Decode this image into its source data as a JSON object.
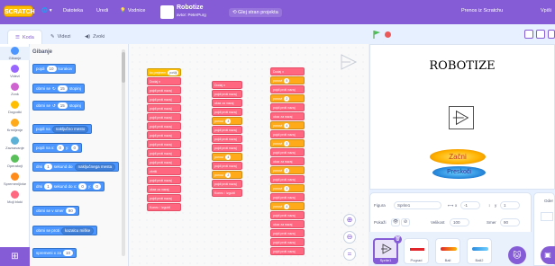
{
  "menubar": {
    "logo": "SCRATCH",
    "language_icon": "globe-icon",
    "file_label": "Datoteka",
    "edit_label": "Uredi",
    "tutorials_label": "Vodnice",
    "project_title": "Robotize",
    "project_author": "avtor: PeterPurg",
    "see_project_page": "Glej stran projekta",
    "share_label": "Prenos iz Scratchu",
    "my_stuff_label": "Vpiši"
  },
  "tabs": {
    "code": "Koda",
    "costumes": "Videzi",
    "sounds": "Zvoki"
  },
  "categories": [
    {
      "label": "Gibanje",
      "color": "#4c97ff"
    },
    {
      "label": "Videzi",
      "color": "#9966ff"
    },
    {
      "label": "Zvok",
      "color": "#cf63cf"
    },
    {
      "label": "Dogodki",
      "color": "#ffbf00"
    },
    {
      "label": "Krmiljenje",
      "color": "#ffab19"
    },
    {
      "label": "Zaznavanje",
      "color": "#5cb1d6"
    },
    {
      "label": "Operatorji",
      "color": "#59c059"
    },
    {
      "label": "Spremenljivke",
      "color": "#ff8c1a"
    },
    {
      "label": "Moji bloki",
      "color": "#ff6680"
    }
  ],
  "palette": {
    "header": "Gibanje",
    "blocks": [
      {
        "a": "pojdi",
        "v": "10",
        "b": "korakov"
      },
      {
        "a": "obrni se",
        "v": "15",
        "b": "stopinj",
        "icon": "↻"
      },
      {
        "a": "obrni se",
        "v": "15",
        "b": "stopinj",
        "icon": "↺"
      },
      {
        "a": "pojdi na",
        "dd": "naključno mesto"
      },
      {
        "a": "pojdi na x:",
        "v": "0",
        "b": "y:",
        "v2": "0"
      },
      {
        "a": "drsi",
        "v": "1",
        "b": "sekund do",
        "dd": "naključnega mesta"
      },
      {
        "a": "drsi",
        "v": "1",
        "b": "sekund do x:",
        "v2": "0",
        "c": "y:",
        "v3": "0"
      },
      {
        "a": "obrni se v smer",
        "v": "90"
      },
      {
        "a": "obrni se proti",
        "dd": "kazalcu miške"
      },
      {
        "a": "spremeni x za",
        "v": "10"
      }
    ]
  },
  "scripts": {
    "col1": [
      {
        "t": "ko prejmem",
        "c": "yellow",
        "o": "pošlji"
      },
      {
        "t": "Dodaj x",
        "c": "pink"
      },
      {
        "t": "pojdi proti nazaj",
        "c": "pink"
      },
      {
        "t": "pojdi proti nazaj",
        "c": "pink"
      },
      {
        "t": "pojdi proti nazaj",
        "c": "pink"
      },
      {
        "t": "pojdi proti nazaj",
        "c": "pink"
      },
      {
        "t": "pojdi proti nazaj",
        "c": "pink"
      },
      {
        "t": "pojdi proti nazaj",
        "c": "pink"
      },
      {
        "t": "pojdi proti nazaj",
        "c": "pink"
      },
      {
        "t": "pojdi proti nazaj",
        "c": "pink"
      },
      {
        "t": "pojdi proti nazaj",
        "c": "pink"
      },
      {
        "t": "zbriši",
        "c": "pink"
      },
      {
        "t": "pojdi proti nazaj",
        "c": "pink"
      },
      {
        "t": "ukaz za nazaj",
        "c": "pink"
      },
      {
        "t": "pojdi proti nazaj",
        "c": "pink"
      },
      {
        "t": "Konec / Izgubil",
        "c": "pink"
      }
    ],
    "col2": [
      {
        "t": "Dodaj x",
        "c": "pink"
      },
      {
        "t": "pojdi proti nazaj",
        "c": "pink"
      },
      {
        "t": "ukaz za nazaj",
        "c": "pink"
      },
      {
        "t": "pojdi proti nazaj",
        "c": "pink"
      },
      {
        "t": "ponovi",
        "c": "orange",
        "o": "3"
      },
      {
        "t": "pojdi proti nazaj",
        "c": "pink"
      },
      {
        "t": "pojdi proti nazaj",
        "c": "pink"
      },
      {
        "t": "pojdi proti nazaj",
        "c": "pink"
      },
      {
        "t": "ponovi",
        "c": "orange",
        "o": "4"
      },
      {
        "t": "pojdi proti nazaj",
        "c": "pink"
      },
      {
        "t": "ponovi",
        "c": "orange",
        "o": "2"
      },
      {
        "t": "pojdi proti nazaj",
        "c": "pink"
      },
      {
        "t": "Konec / Izgubil",
        "c": "pink"
      }
    ],
    "col3": [
      {
        "t": "Dodaj x",
        "c": "pink"
      },
      {
        "t": "ponovi",
        "c": "orange",
        "o": "5"
      },
      {
        "t": "pojdi proti nazaj",
        "c": "pink"
      },
      {
        "t": "ponovi",
        "c": "orange",
        "o": "2"
      },
      {
        "t": "pojdi proti nazaj",
        "c": "pink"
      },
      {
        "t": "ukaz za nazaj",
        "c": "pink"
      },
      {
        "t": "ponovi",
        "c": "orange",
        "o": "4"
      },
      {
        "t": "pojdi proti nazaj",
        "c": "pink"
      },
      {
        "t": "ponovi",
        "c": "orange",
        "o": "3"
      },
      {
        "t": "pojdi proti nazaj",
        "c": "pink"
      },
      {
        "t": "ukaz za nazaj",
        "c": "pink"
      },
      {
        "t": "ponovi",
        "c": "orange",
        "o": "2"
      },
      {
        "t": "pojdi proti nazaj",
        "c": "pink"
      },
      {
        "t": "ponovi",
        "c": "orange",
        "o": "3"
      },
      {
        "t": "pojdi proti nazaj",
        "c": "pink"
      },
      {
        "t": "ponovi",
        "c": "orange",
        "o": "4"
      },
      {
        "t": "pojdi proti nazaj",
        "c": "pink"
      },
      {
        "t": "ukaz za nazaj",
        "c": "pink"
      },
      {
        "t": "pojdi proti nazaj",
        "c": "pink"
      },
      {
        "t": "pojdi proti nazaj",
        "c": "pink"
      },
      {
        "t": "pojdi proti nazaj",
        "c": "pink"
      }
    ]
  },
  "stage": {
    "title": "ROBOTIZE",
    "start_button": "Začni",
    "exit_button": "Preskoči"
  },
  "sprite_info": {
    "sprite_label": "Figura",
    "sprite_name": "Sprite1",
    "x_label": "x",
    "x_value": "-1",
    "y_label": "y",
    "y_value": "1",
    "show_label": "Pokaži",
    "size_label": "Velikost",
    "size_value": "100",
    "direction_label": "Smer",
    "direction_value": "90"
  },
  "sprites": [
    {
      "name": "Sprite1",
      "selected": true
    },
    {
      "name": "Pograd",
      "selected": false
    },
    {
      "name": "Ball",
      "selected": false
    },
    {
      "name": "Ball2",
      "selected": false
    }
  ],
  "stage_target": {
    "label": "Oder"
  }
}
